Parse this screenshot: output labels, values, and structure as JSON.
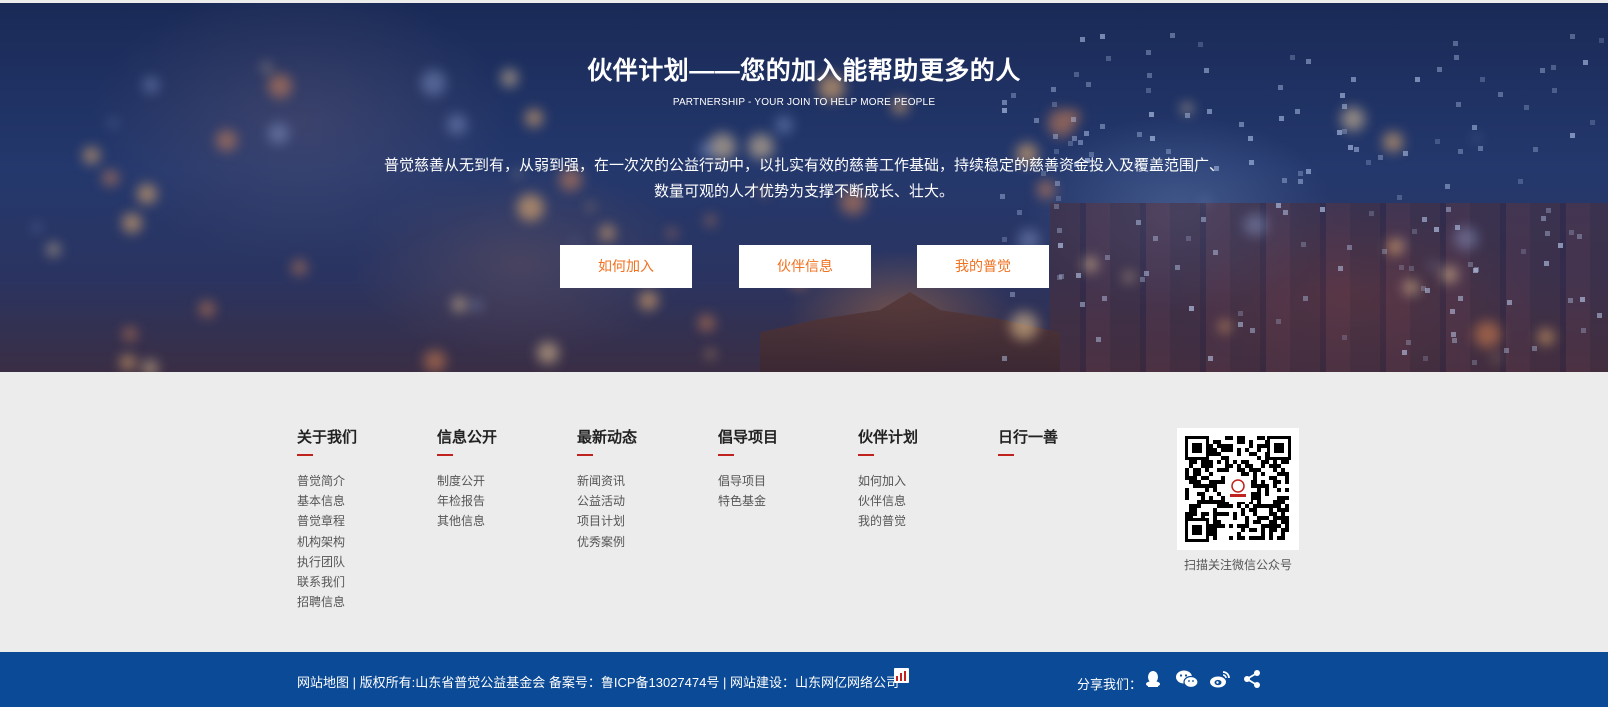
{
  "hero": {
    "title": "伙伴计划——您的加入能帮助更多的人",
    "subtitle": "PARTNERSHIP - YOUR JOIN TO HELP MORE PEOPLE",
    "description": "普觉慈善从无到有，从弱到强，在一次次的公益行动中，以扎实有效的慈善工作基础，持续稳定的慈善资金投入及覆盖范围广、数量可观的人才优势为支撑不断成长、壮大。",
    "buttons": [
      "如何加入",
      "伙伴信息",
      "我的普觉"
    ],
    "button_text_color": "#f1711f"
  },
  "footer": {
    "columns": [
      {
        "title": "关于我们",
        "links": [
          "普觉简介",
          "基本信息",
          "普觉章程",
          "机构架构",
          "执行团队",
          "联系我们",
          "招聘信息"
        ]
      },
      {
        "title": "信息公开",
        "links": [
          "制度公开",
          "年检报告",
          "其他信息"
        ]
      },
      {
        "title": "最新动态",
        "links": [
          "新闻资讯",
          "公益活动",
          "项目计划",
          "优秀案例"
        ]
      },
      {
        "title": "倡导项目",
        "links": [
          "倡导项目",
          "特色基金"
        ]
      },
      {
        "title": "伙伴计划",
        "links": [
          "如何加入",
          "伙伴信息",
          "我的普觉"
        ]
      },
      {
        "title": "日行一善",
        "links": []
      }
    ],
    "accent_color": "#c0221d",
    "qr_caption": "扫描关注微信公众号"
  },
  "bottom": {
    "sitemap": "网站地图",
    "copyright": " | 版权所有:山东省普觉公益基金会 备案号：鲁ICP备13027474号 | 网站建设：山东网亿网络公司",
    "share_label": "分享我们：",
    "share_icons": [
      "qq-icon",
      "wechat-icon",
      "weibo-icon",
      "share-icon"
    ],
    "bar_color": "#0b4a96"
  }
}
